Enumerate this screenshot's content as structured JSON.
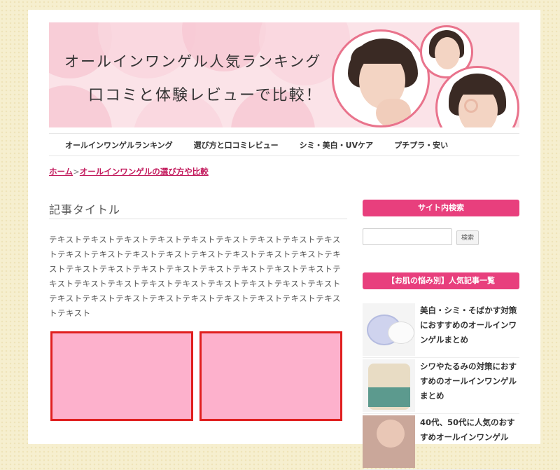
{
  "banner": {
    "title_line1": "オールインワンゲル人気ランキング",
    "title_line2": "口コミと体験レビューで比較！"
  },
  "nav": {
    "items": [
      {
        "label": "オールインワンゲルランキング"
      },
      {
        "label": "選び方と口コミレビュー"
      },
      {
        "label": "シミ・美白・UVケア"
      },
      {
        "label": "プチプラ・安い"
      }
    ]
  },
  "breadcrumb": {
    "home": "ホーム",
    "separator": ">",
    "current": "オールインワンゲルの選び方や比較"
  },
  "article": {
    "title": "記事タイトル",
    "body": "テキストテキストテキストテキストテキストテキストテキストテキストテキストテキストテキストテキストテキストテキストテキストテキストテキストテキストテキストテキストテキストテキストテキストテキストテキストテキストテキストテキストテキストテキストテキストテキストテキストテキストテキストテキストテキストテキストテキストテキストテキストテキストテキストテキストテキスト"
  },
  "sidebar": {
    "search_heading": "サイト内検索",
    "search_button": "検索",
    "popular_heading": "【お肌の悩み別】人気記事一覧",
    "articles": [
      {
        "title": "美白・シミ・そばかす対策におすすめのオールインワンゲルまとめ"
      },
      {
        "title": "シワやたるみの対策におすすめのオールインワンゲルまとめ"
      },
      {
        "title": "40代、50代に人気のおすすめオールインワンゲル"
      }
    ]
  },
  "colors": {
    "accent": "#e83f7d",
    "link": "#c2185b",
    "ad_fill": "#fdb1cc",
    "ad_border": "#e01f1f"
  }
}
